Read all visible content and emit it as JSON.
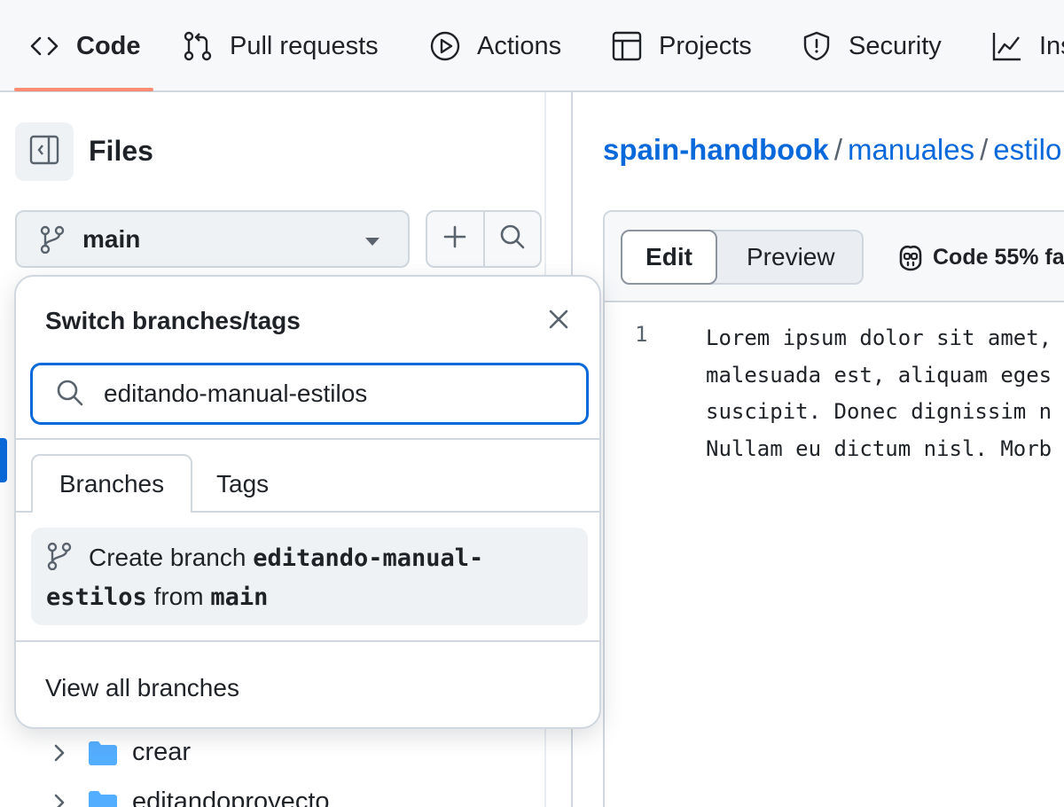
{
  "nav": {
    "tabs": [
      {
        "label": "Code",
        "icon": "code-icon"
      },
      {
        "label": "Pull requests",
        "icon": "pull-request-icon"
      },
      {
        "label": "Actions",
        "icon": "play-icon"
      },
      {
        "label": "Projects",
        "icon": "table-icon"
      },
      {
        "label": "Security",
        "icon": "shield-icon"
      },
      {
        "label": "Ins",
        "icon": "graph-icon"
      }
    ],
    "active_tab": "Code",
    "active_underline_color": "#fd8c73"
  },
  "sidebar": {
    "title": "Files",
    "branch": "main",
    "tree": [
      {
        "name": "crear",
        "type": "folder"
      },
      {
        "name": "editandoproyecto",
        "type": "folder"
      }
    ]
  },
  "breadcrumb": {
    "repo": "spain-handbook",
    "path": [
      "manuales",
      "estilo"
    ]
  },
  "editor": {
    "edit_label": "Edit",
    "preview_label": "Preview",
    "copilot_label": "Code 55% fa",
    "line_numbers": [
      "1"
    ],
    "lines": [
      "Lorem ipsum dolor sit amet,",
      "malesuada est, aliquam eges",
      "suscipit. Donec dignissim n",
      "Nullam eu dictum nisl. Morb"
    ]
  },
  "popover": {
    "title": "Switch branches/tags",
    "search_value": "editando-manual-estilos",
    "tabs": [
      "Branches",
      "Tags"
    ],
    "active_tab": "Branches",
    "create_prefix": "Create branch",
    "create_branch": "editando-manual-estilos",
    "create_branch_first": "editando-manual-",
    "create_branch_rest": "estilos",
    "create_from": "from",
    "create_base": "main",
    "view_all": "View all branches"
  },
  "colors": {
    "link": "#0969da",
    "focus_border": "#0969da",
    "folder": "#54aeff",
    "border": "#d0d7de"
  }
}
